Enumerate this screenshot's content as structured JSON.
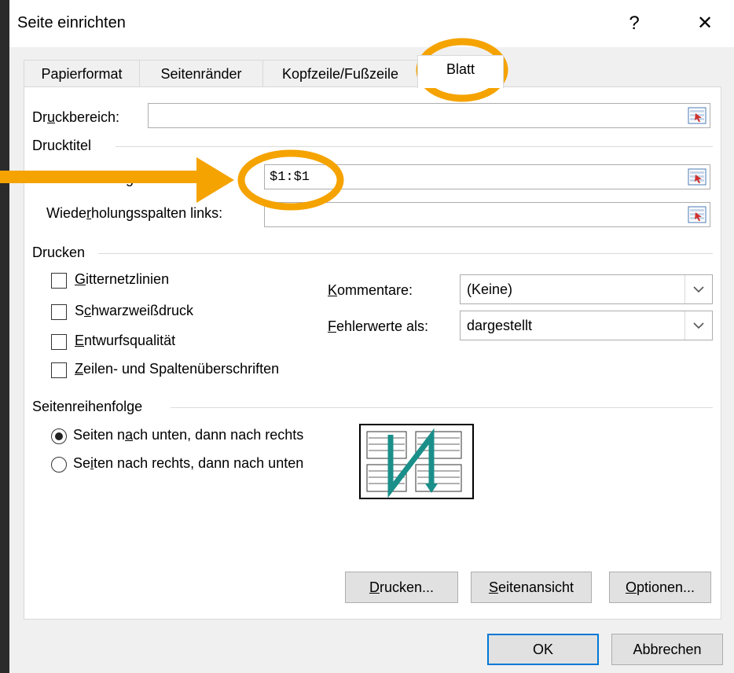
{
  "window": {
    "title": "Seite einrichten",
    "help_glyph": "?",
    "close_glyph": "✕"
  },
  "tabs": [
    {
      "label": "Papierformat"
    },
    {
      "label": "Seitenränder"
    },
    {
      "label": "Kopfzeile/Fußzeile"
    },
    {
      "label": "Blatt",
      "active": true
    }
  ],
  "print_area": {
    "label_pre": "Dr",
    "label_acc": "u",
    "label_post": "ckbereich:",
    "value": ""
  },
  "print_titles": {
    "group": "Drucktitel",
    "rows_label": "Wiederholungszeilen oben:",
    "rows_value": "$1:$1",
    "cols_label_pre": "Wiede",
    "cols_label_acc": "r",
    "cols_label_post": "holungsspalten links:",
    "cols_value": ""
  },
  "print": {
    "group": "Drucken",
    "checkboxes": [
      {
        "acc": "G",
        "rest": "itternetzlinien",
        "checked": false
      },
      {
        "pre": "S",
        "acc": "c",
        "rest": "hwarzweißdruck",
        "checked": false
      },
      {
        "acc": "E",
        "rest": "ntwurfsqualität",
        "checked": false
      },
      {
        "acc": "Z",
        "rest": "eilen- und Spaltenüberschriften",
        "checked": false
      }
    ],
    "comments": {
      "acc": "K",
      "rest": "ommentare:",
      "value": "(Keine)"
    },
    "errors": {
      "acc": "F",
      "rest": "ehlerwerte als:",
      "value": "dargestellt"
    }
  },
  "order": {
    "group": "Seitenreihenfolge",
    "options": [
      {
        "pre": "Seiten n",
        "acc": "a",
        "rest": "ch unten, dann nach rechts",
        "selected": true
      },
      {
        "pre": "Se",
        "acc": "i",
        "rest": "ten nach rechts, dann nach unten",
        "selected": false
      }
    ]
  },
  "buttons": {
    "print": {
      "acc": "D",
      "rest": "rucken..."
    },
    "preview": {
      "acc": "S",
      "rest": "eitenansicht"
    },
    "options": {
      "acc": "O",
      "rest": "ptionen..."
    },
    "ok": "OK",
    "cancel": "Abbrechen"
  },
  "colors": {
    "highlight": "#f5a300",
    "accent": "#0078d7",
    "icon_teal": "#1a8f8a"
  },
  "icons": {
    "refedit": "range-select-icon",
    "dropdown": "chevron-down-icon"
  }
}
